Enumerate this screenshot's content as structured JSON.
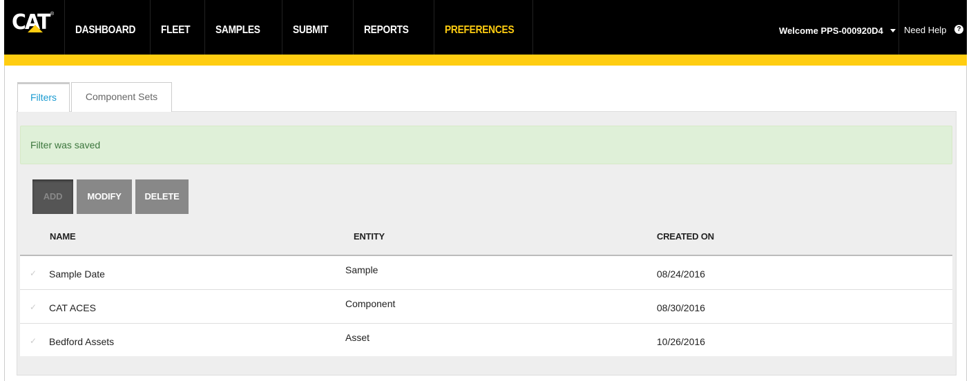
{
  "logo": {
    "text": "CAT",
    "reg": "®"
  },
  "nav": {
    "items": [
      {
        "label": "DASHBOARD",
        "active": false
      },
      {
        "label": "FLEET",
        "active": false
      },
      {
        "label": "SAMPLES",
        "active": false
      },
      {
        "label": "SUBMIT",
        "active": false
      },
      {
        "label": "REPORTS",
        "active": false
      },
      {
        "label": "PREFERENCES",
        "active": true
      }
    ],
    "welcome": "Welcome PPS-000920D4",
    "help_label": "Need Help",
    "help_icon": "?"
  },
  "tabs": [
    {
      "label": "Filters",
      "active": true
    },
    {
      "label": "Component Sets",
      "active": false
    }
  ],
  "alert": {
    "message": "Filter was saved"
  },
  "toolbar": {
    "add_label": "ADD",
    "modify_label": "MODIFY",
    "delete_label": "DELETE"
  },
  "table": {
    "columns": [
      "NAME",
      "ENTITY",
      "CREATED ON"
    ],
    "rows": [
      {
        "check": "✓",
        "name": "Sample Date",
        "entity": "Sample",
        "created_on": "08/24/2016"
      },
      {
        "check": "✓",
        "name": "CAT ACES",
        "entity": "Component",
        "created_on": "08/30/2016"
      },
      {
        "check": "✓",
        "name": "Bedford Assets",
        "entity": "Asset",
        "created_on": "10/26/2016"
      }
    ]
  },
  "colors": {
    "nav_bg": "#000000",
    "brand_yellow": "#ffcd11",
    "tab_active": "#1a9bd1",
    "alert_bg": "#dff0d8",
    "alert_text": "#3c763d",
    "button_bg": "#888888"
  }
}
